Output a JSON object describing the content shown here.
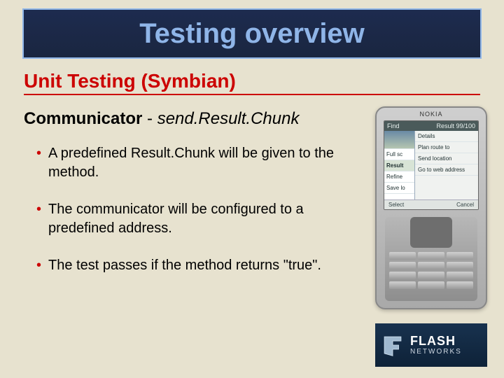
{
  "title": "Testing overview",
  "subtitle": "Unit Testing (Symbian)",
  "heading": {
    "strong": "Communicator",
    "sep": " - ",
    "italic": "send.Result.Chunk"
  },
  "bullets": [
    "A predefined Result.Chunk will be given to the method.",
    "The communicator will be configured to a predefined address.",
    "The test passes if the method returns \"true\"."
  ],
  "phone": {
    "brand": "NOKIA",
    "header_left": "Find",
    "header_right": "Result 99/100",
    "left_items": [
      "Full sc",
      "Result",
      "Refine",
      "Save lo"
    ],
    "right_items": [
      "Details",
      "Plan route to",
      "Send location",
      "Go to web address"
    ],
    "footer_left": "Select",
    "footer_right": "Cancel"
  },
  "logo": {
    "line1": "FLASH",
    "line2": "NETWORKS"
  }
}
